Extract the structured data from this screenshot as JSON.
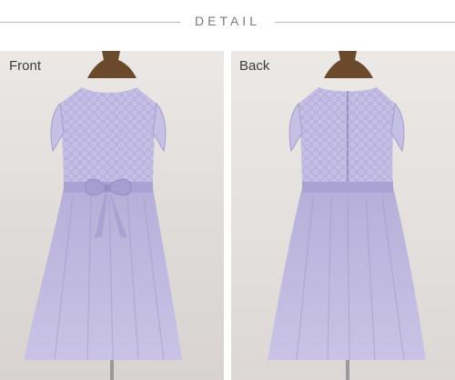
{
  "header": {
    "title": "DETAIL"
  },
  "views": {
    "front_label": "Front",
    "back_label": "Back"
  },
  "colors": {
    "dress_lavender": "#b9b2dc",
    "dress_shadow": "#9e96c9",
    "mannequin_brown": "#6b4a2c",
    "background": "#e6e2df"
  }
}
